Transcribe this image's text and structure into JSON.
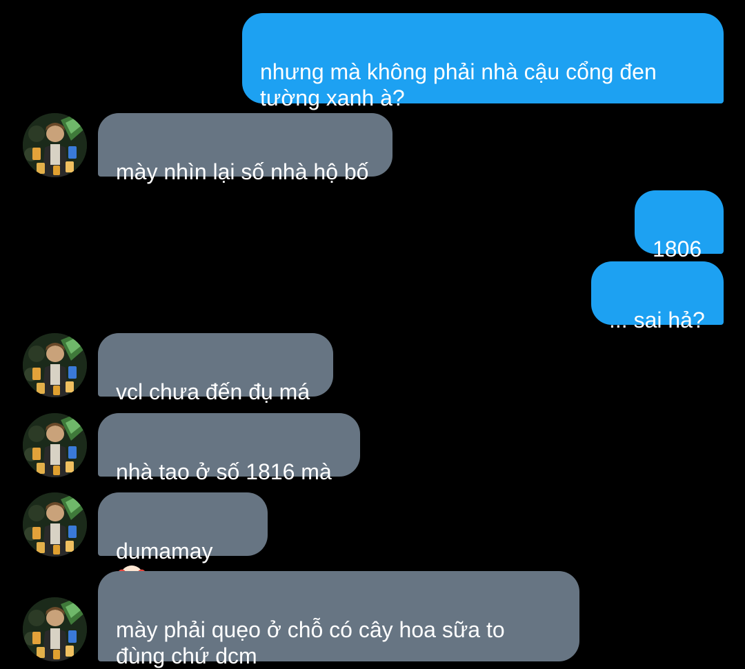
{
  "theme": {
    "background": "#000000",
    "sent_bubble_color": "#1da1f2",
    "received_bubble_color": "#677583",
    "text_color": "#ffffff"
  },
  "messages": [
    {
      "sender": "me",
      "text": "nhưng mà không phải nhà cậu cổng đen\ntường xanh à?"
    },
    {
      "sender": "them",
      "text": "mày nhìn lại số nhà hộ bố"
    },
    {
      "sender": "me",
      "text": "1806"
    },
    {
      "sender": "me",
      "text": "... sai hả?"
    },
    {
      "sender": "them",
      "text": "vcl chưa đến đụ má"
    },
    {
      "sender": "them",
      "text": "nhà tao ở số 1816 mà"
    },
    {
      "sender": "them",
      "text": "dumamay",
      "emoji": "clown-face-emoji"
    },
    {
      "sender": "them",
      "text": "mày phải quẹo ở chỗ có cây hoa sữa to\nđùng chứ dcm"
    }
  ]
}
